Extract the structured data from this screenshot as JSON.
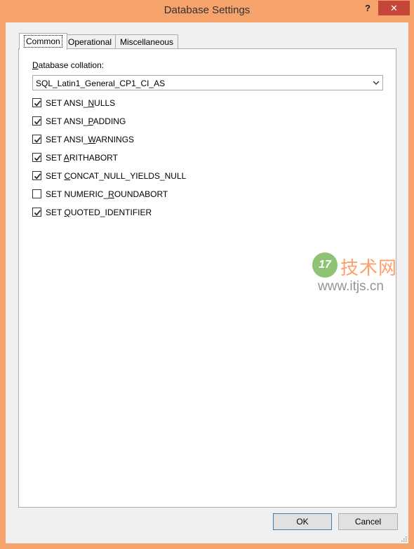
{
  "window": {
    "title": "Database Settings",
    "help_label": "?",
    "close_label": "✕"
  },
  "tabs": [
    {
      "label": "Common",
      "active": true
    },
    {
      "label": "Operational",
      "active": false
    },
    {
      "label": "Miscellaneous",
      "active": false
    }
  ],
  "common": {
    "collation_label": "Database collation:",
    "collation_value": "SQL_Latin1_General_CP1_CI_AS",
    "options": [
      {
        "pre": "SET ANSI_",
        "mn": "N",
        "post": "ULLS",
        "checked": true
      },
      {
        "pre": "SET ANSI_",
        "mn": "P",
        "post": "ADDING",
        "checked": true
      },
      {
        "pre": "SET ANSI_",
        "mn": "W",
        "post": "ARNINGS",
        "checked": true
      },
      {
        "pre": "SET ",
        "mn": "A",
        "post": "RITHABORT",
        "checked": true
      },
      {
        "pre": "SET ",
        "mn": "C",
        "post": "ONCAT_NULL_YIELDS_NULL",
        "checked": true
      },
      {
        "pre": "SET NUMERIC_",
        "mn": "R",
        "post": "OUNDABORT",
        "checked": false
      },
      {
        "pre": "SET ",
        "mn": "Q",
        "post": "UOTED_IDENTIFIER",
        "checked": true
      }
    ]
  },
  "buttons": {
    "ok_label": "OK",
    "cancel_label": "Cancel"
  },
  "watermark": {
    "badge": "17",
    "brand": "技术网",
    "url": "www.itjs.cn"
  },
  "colors": {
    "frame": "#f5a26b",
    "close": "#c7463a",
    "ok_border": "#3c7fb1"
  }
}
